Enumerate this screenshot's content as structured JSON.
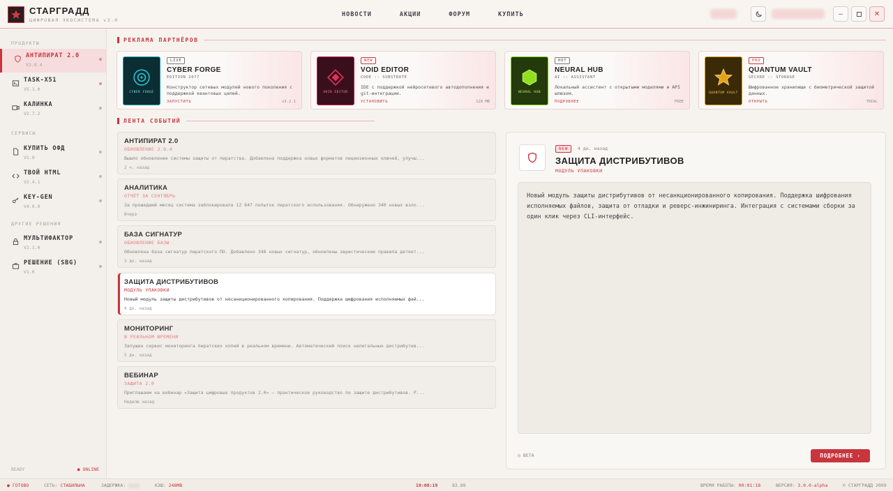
{
  "app": {
    "name": "СТАРГРАДД",
    "subtitle": "ЦИФРОВАЯ ЭКОСИСТЕМА v3.0"
  },
  "nav": [
    "НОВОСТИ",
    "АКЦИИ",
    "ФОРУМ",
    "КУПИТЬ"
  ],
  "sidebar": {
    "sections": [
      {
        "title": "ПРОДУКТЫ",
        "items": [
          {
            "name": "АНТИПИРАТ 2.0",
            "version": "V2.0.4",
            "icon": "shield-icon",
            "active": true
          },
          {
            "name": "TASK-X51",
            "version": "V5.1.0",
            "icon": "terminal-icon"
          },
          {
            "name": "КАЛИНКА",
            "version": "V2.7.2",
            "icon": "video-camera-icon"
          }
        ]
      },
      {
        "title": "СЕРВИСЫ",
        "items": [
          {
            "name": "КУПИТЬ ОФД",
            "version": "V1.0",
            "icon": "document-icon"
          },
          {
            "name": "ТВОЙ HTML",
            "version": "V2.4.1",
            "icon": "code-icon"
          },
          {
            "name": "KEY-GEN",
            "version": "V4.0.0",
            "icon": "key-icon"
          }
        ]
      },
      {
        "title": "ДРУГИЕ РЕШЕНИЯ",
        "items": [
          {
            "name": "МУЛЬТИФАКТОР",
            "version": "V2.1.0",
            "icon": "lock-icon"
          },
          {
            "name": "РЕШЕНИЕ (SBG)",
            "version": "V1.0",
            "icon": "briefcase-icon"
          }
        ]
      }
    ],
    "footer_left": "READY",
    "footer_right": "● ONLINE"
  },
  "partners": {
    "title": "РЕКЛАМА ПАРТНЁРОВ",
    "cards": [
      {
        "tag": "LIVE",
        "title": "CYBER FORGE",
        "sub": "EDITION 2077",
        "desc": "Конструктор сетевых модулей нового поколения с поддержкой квантовых цепей.",
        "action": "ЗАПУСТИТЬ",
        "meta": "v3.2.1",
        "thumb_label": "CYBER FORGE",
        "color": "#1fa3b0"
      },
      {
        "tag": "NEW",
        "title": "VOID EDITOR",
        "sub": "CODE :: SUBSTRATE",
        "desc": "IDE с поддержкой нейросетевого автодополнения и git-интеграции.",
        "action": "УСТАНОВИТЬ",
        "meta": "128 MB",
        "thumb_label": "VOID EDITOR",
        "color": "#c61f4b"
      },
      {
        "tag": "HOT",
        "title": "NEURAL HUB",
        "sub": "AI :: ASSISTANT",
        "desc": "Локальный ассистент с открытыми моделями и API шлюзом.",
        "action": "ПОДРОБНЕЕ",
        "meta": "FREE",
        "thumb_label": "NEURAL HUB",
        "color": "#7fd11b"
      },
      {
        "tag": "PRO",
        "title": "QUANTUM VAULT",
        "sub": "SECURE :: STORAGE",
        "desc": "Шифрованное хранилище с биометрической защитой данных.",
        "action": "ОТКРЫТЬ",
        "meta": "TRIAL",
        "thumb_label": "QUANTUM VAULT",
        "color": "#d99a12"
      }
    ]
  },
  "feed": {
    "title": "ЛЕНТА СОБЫТИЙ",
    "items": [
      {
        "title": "АНТИПИРАТ 2.0",
        "sub": "ОБНОВЛЕНИЕ 2.0.4",
        "desc": "Вышло обновление системы защиты от пиратства. Добавлена поддержка новых форматов лицензионных ключей, улучш...",
        "when": "2 ч. назад"
      },
      {
        "title": "АНАЛИТИКА",
        "sub": "ОТЧЁТ ЗА СЕНТЯБРЬ",
        "desc": "За прошедший месяц система заблокировала 12 847 попыток пиратского использования. Обнаружено 340 новых взло...",
        "when": "Вчера"
      },
      {
        "title": "БАЗА СИГНАТУР",
        "sub": "ОБНОВЛЕНИЕ БАЗЫ",
        "desc": "Обновлена база сигнатур пиратского ПО. Добавлено 348 новых сигнатур, обновлены эвристические правила детект...",
        "when": "3 дн. назад"
      },
      {
        "title": "ЗАЩИТА ДИСТРИБУТИВОВ",
        "sub": "МОДУЛЬ УПАКОВКИ",
        "desc": "Новый модуль защиты дистрибутивов от несанкционированного копирования. Поддержка шифрования исполняемых фай...",
        "when": "4 дн. назад",
        "selected": true
      },
      {
        "title": "МОНИТОРИНГ",
        "sub": "В РЕАЛЬНОМ ВРЕМЕНИ",
        "desc": "Запущен сервис мониторинга пиратских копий в реальном времени. Автоматический поиск нелегальных дистрибутив...",
        "when": "5 дн. назад"
      },
      {
        "title": "ВЕБИНАР",
        "sub": "ЗАЩИТА 2.0",
        "desc": "Приглашаем на вебинар «Защита цифровых продуктов 2.0» — практическое руководство по защите дистрибутивов. Р...",
        "when": "Неделю назад"
      }
    ]
  },
  "detail": {
    "tag": "NEW",
    "time": "4 дн. назад",
    "title": "ЗАЩИТА ДИСТРИБУТИВОВ",
    "sub": "МОДУЛЬ УПАКОВКИ",
    "body": "Новый модуль защиты дистрибутивов от несанкционированного копирования. Поддержка шифрования исполняемых файлов, защита от отладки и реверс-инжиниринга. Интеграция с системами сборки за один клик через CLI-интерфейс.",
    "beta": "BETA",
    "button": "ПОДРОБНЕЕ ›"
  },
  "status": {
    "ready": "● ГОТОВО",
    "net_label": "СЕТЬ:",
    "net_value": "СТАБИЛЬНА",
    "lat_label": "ЗАДЕРЖКА:",
    "kvs_label": "КЭШ:",
    "kvs_value": "248MB",
    "clock": "19:08:19",
    "fps": "83.89",
    "uptime_label": "ВРЕМЯ РАБОТЫ:",
    "uptime_value": "00:01:18",
    "version_label": "ВЕРСИЯ:",
    "version_value": "3.0.0-alpha",
    "copyright": "© СТАРГРАДД 2099"
  },
  "colors": {
    "accent": "#c9353d",
    "bg": "#f6f3ee"
  }
}
